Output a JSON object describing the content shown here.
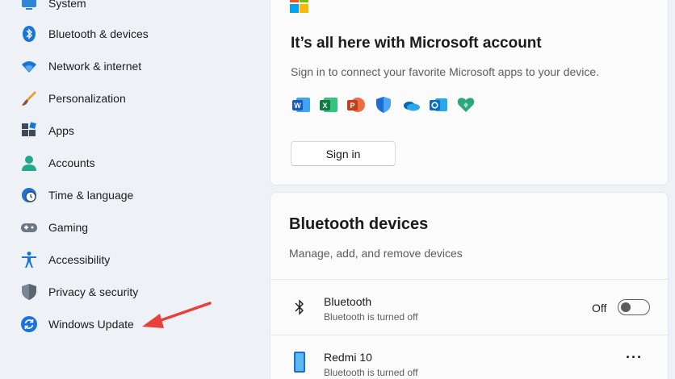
{
  "sidebar": {
    "items": [
      {
        "label": "System",
        "icon": "system-icon"
      },
      {
        "label": "Bluetooth & devices",
        "icon": "bluetooth-icon"
      },
      {
        "label": "Network & internet",
        "icon": "wifi-icon"
      },
      {
        "label": "Personalization",
        "icon": "brush-icon"
      },
      {
        "label": "Apps",
        "icon": "apps-icon"
      },
      {
        "label": "Accounts",
        "icon": "person-icon"
      },
      {
        "label": "Time & language",
        "icon": "clock-globe-icon"
      },
      {
        "label": "Gaming",
        "icon": "gamepad-icon"
      },
      {
        "label": "Accessibility",
        "icon": "accessibility-icon"
      },
      {
        "label": "Privacy & security",
        "icon": "shield-icon"
      },
      {
        "label": "Windows Update",
        "icon": "windows-update-icon"
      }
    ]
  },
  "microsoft_card": {
    "title": "It’s all here with Microsoft account",
    "subtitle": "Sign in to connect your favorite Microsoft apps to your device.",
    "apps": [
      "word-icon",
      "excel-icon",
      "powerpoint-icon",
      "defender-icon",
      "onedrive-icon",
      "outlook-icon",
      "family-safety-icon"
    ],
    "signin_label": "Sign in"
  },
  "bluetooth_card": {
    "title": "Bluetooth devices",
    "subtitle": "Manage, add, and remove devices",
    "devices": [
      {
        "name": "Bluetooth",
        "status": "Bluetooth is turned off",
        "control": "toggle",
        "toggle_label": "Off",
        "icon": "bluetooth-icon"
      },
      {
        "name": "Redmi 10",
        "status": "Bluetooth is turned off",
        "control": "more",
        "more_label": "···",
        "icon": "phone-icon"
      }
    ]
  },
  "colors": {
    "accent": "#0067c0",
    "annotation_arrow": "#e8403a"
  }
}
